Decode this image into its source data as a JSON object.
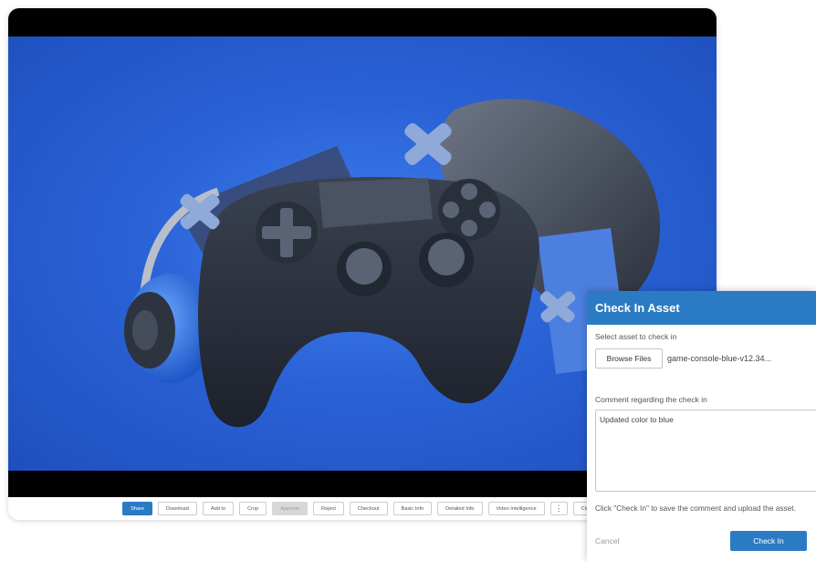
{
  "toolbar": {
    "buttons": [
      {
        "label": "Share"
      },
      {
        "label": "Download"
      },
      {
        "label": "Add to"
      },
      {
        "label": "Crop"
      },
      {
        "label": "Approve"
      },
      {
        "label": "Reject"
      },
      {
        "label": "Checkout"
      },
      {
        "label": "Basic Info"
      },
      {
        "label": "Detailed Info"
      },
      {
        "label": "Video Intelligence"
      },
      {
        "label": "⋮"
      },
      {
        "label": "Close"
      }
    ]
  },
  "dialog": {
    "title": "Check In Asset",
    "select_label": "Select asset to check in",
    "browse_label": "Browse Files",
    "file_name": "game-console-blue-v12.34...",
    "comment_label": "Comment regarding the check in",
    "comment_value": "Updated color to blue",
    "hint": "Click \"Check In\" to save the comment and upload the asset.",
    "cancel_label": "Cancel",
    "submit_label": "Check In"
  },
  "colors": {
    "accent": "#2b7bc4",
    "image_background": "#2a62d6"
  }
}
